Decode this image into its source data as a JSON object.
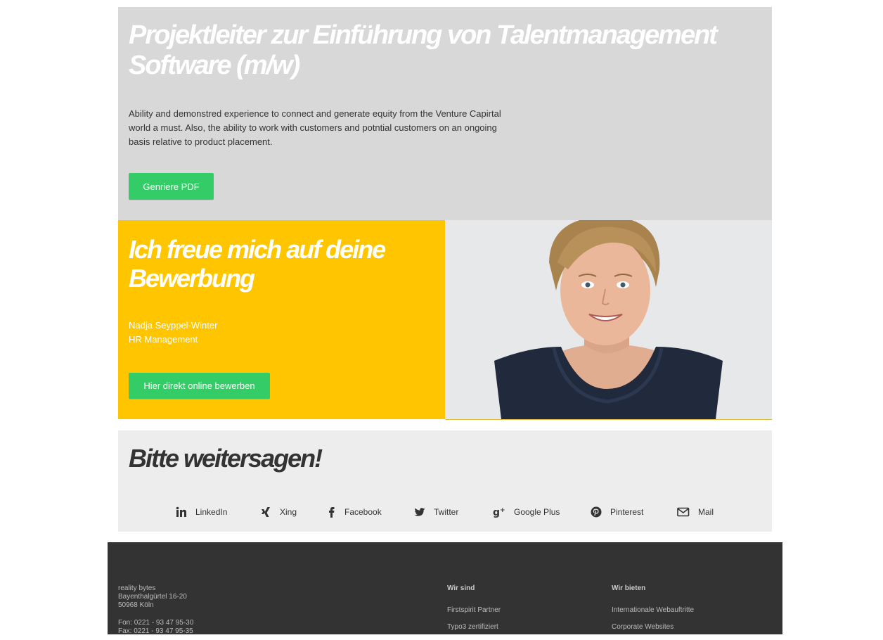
{
  "job": {
    "title": "Projektleiter zur Einführung von Talentmanagement Software (m/w)",
    "description": "Ability and demonstred experience to connect and generate equity from the Venture Capirtal world a must. Also, the ability to work with customers and potntial customers on an ongoing basis relative to product placement.",
    "pdf_button": "Genriere PDF"
  },
  "apply": {
    "title": "Ich freue mich auf deine Bewerbung",
    "contact_name": "Nadja Seyppel-Winter",
    "contact_role": "HR Management",
    "apply_button": "Hier direkt online bewerben"
  },
  "share": {
    "title": "Bitte weitersagen!",
    "items": [
      {
        "label": "LinkedIn",
        "icon": "linkedin-icon"
      },
      {
        "label": "Xing",
        "icon": "xing-icon"
      },
      {
        "label": "Facebook",
        "icon": "facebook-icon"
      },
      {
        "label": "Twitter",
        "icon": "twitter-icon"
      },
      {
        "label": "Google Plus",
        "icon": "google-plus-icon"
      },
      {
        "label": "Pinterest",
        "icon": "pinterest-icon"
      },
      {
        "label": "Mail",
        "icon": "mail-icon"
      }
    ]
  },
  "footer": {
    "address": {
      "company": "reality bytes",
      "street": "Bayenthalgürtel 16-20",
      "city": "50968 Köln",
      "phone": "Fon: 0221 - 93 47 95-30",
      "fax": "Fax: 0221 - 93 47 95-35"
    },
    "wir_sind": {
      "heading": "Wir sind",
      "links": [
        "Firstspirit Partner",
        "Typo3 zertifiziert"
      ]
    },
    "wir_bieten": {
      "heading": "Wir bieten",
      "links": [
        "Internationale Webauftritte",
        "Corporate Websites"
      ]
    }
  },
  "colors": {
    "job_bg": "#d8d8d8",
    "apply_bg": "#ffc600",
    "share_bg": "#ededed",
    "footer_bg": "#333333",
    "button": "#33cc66"
  }
}
